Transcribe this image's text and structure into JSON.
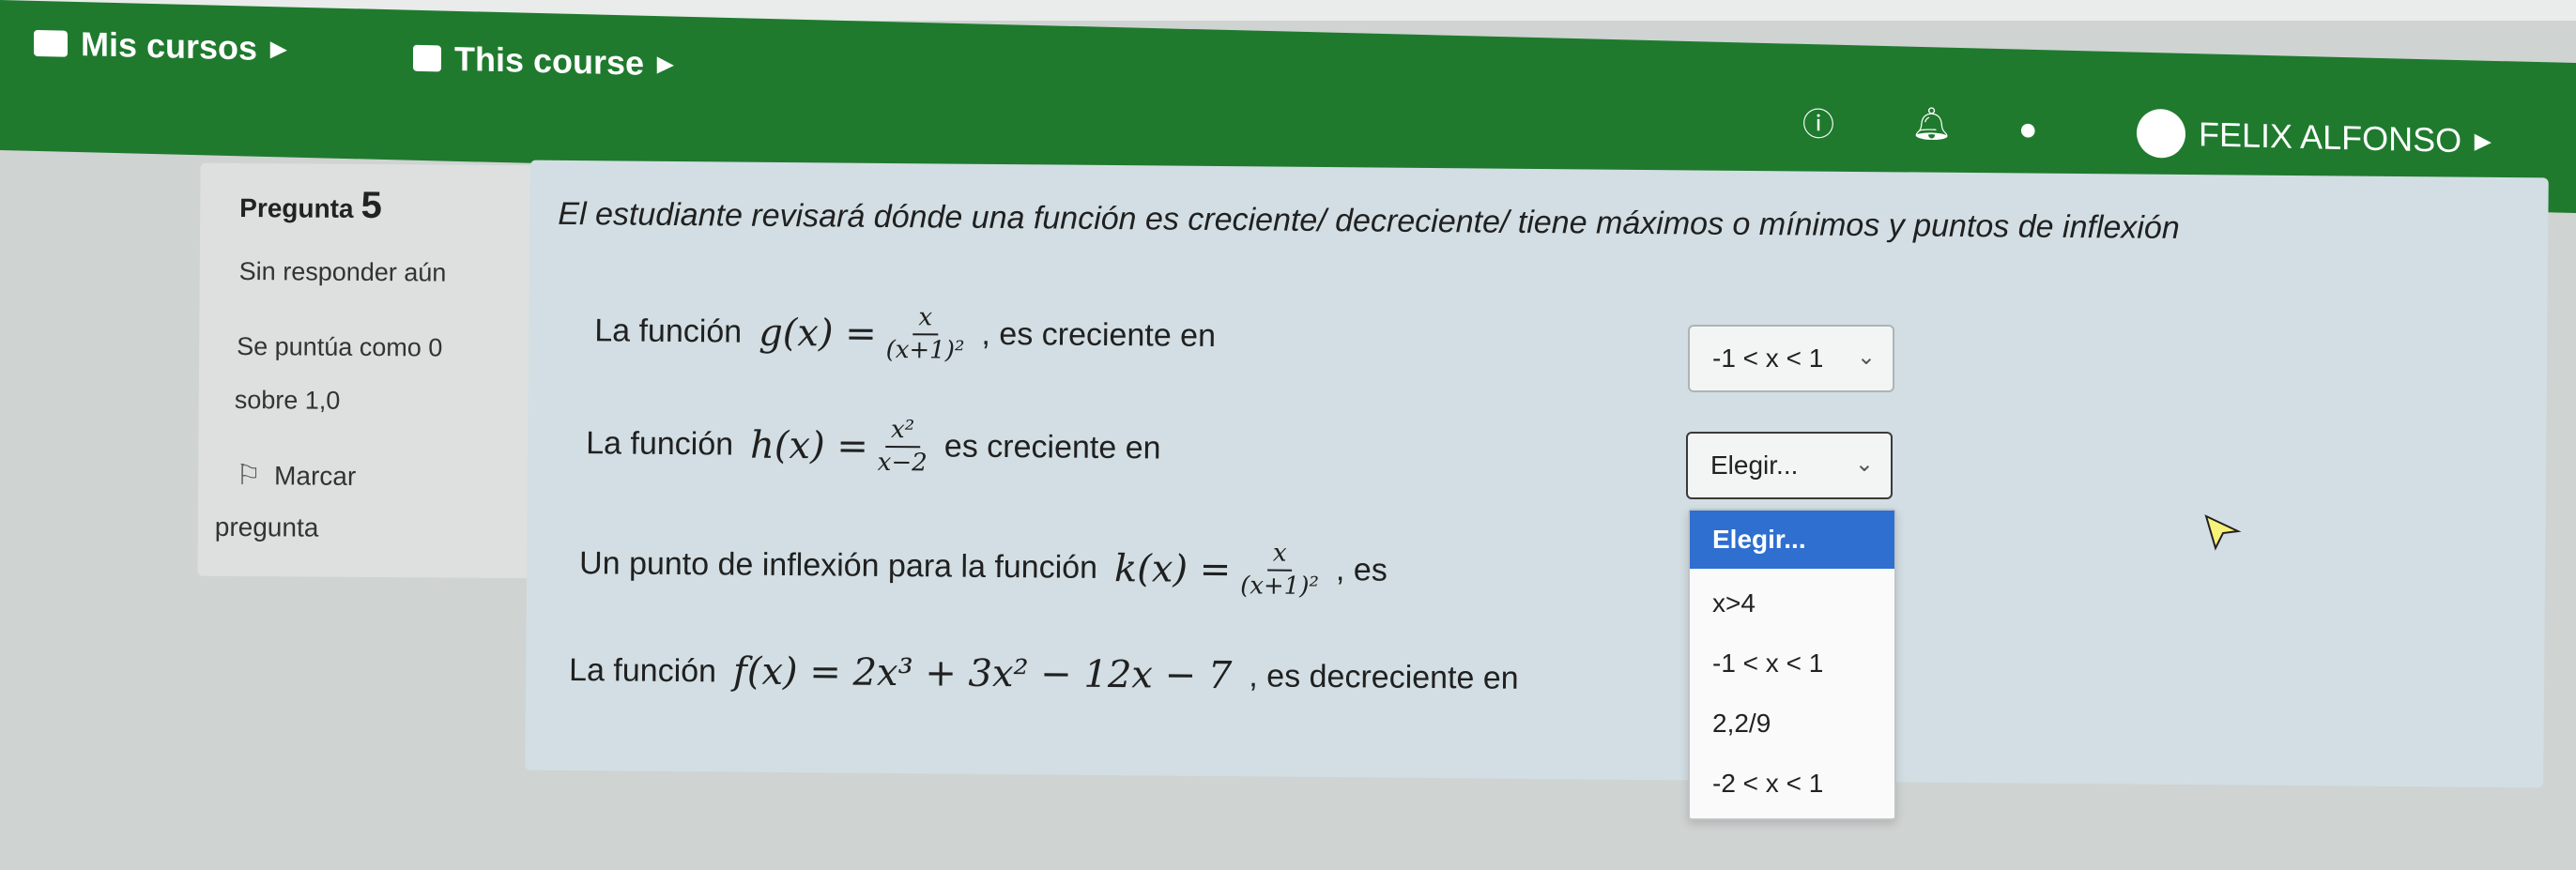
{
  "header": {
    "nav": [
      {
        "label": "Mis cursos"
      },
      {
        "label": "This course"
      }
    ],
    "user_name": "FELIX ALFONSO"
  },
  "question": {
    "label": "Pregunta",
    "number": "5",
    "status": "Sin responder aún",
    "grade_line1": "Se puntúa como 0",
    "grade_line2": "sobre 1,0",
    "flag_line1": "Marcar",
    "flag_line2": "pregunta"
  },
  "content": {
    "intro": "El estudiante revisará dónde una función es creciente/ decreciente/ tiene máximos o mínimos y puntos de inflexión",
    "items": [
      {
        "prefix": "La función",
        "func": "g(x) =",
        "num": "x",
        "den": "(x+1)²",
        "suffix": ", es creciente en",
        "selected": "-1 < x < 1"
      },
      {
        "prefix": "La función",
        "func": "h(x) =",
        "num": "x²",
        "den": "x−2",
        "suffix": "es creciente en",
        "selected": "Elegir..."
      },
      {
        "prefix": "Un punto de inflexión para la función",
        "func": "k(x) =",
        "num": "x",
        "den": "(x+1)²",
        "suffix": ", es",
        "selected": "Elegir..."
      },
      {
        "prefix": "La función",
        "func": "f(x) = 2x³ + 3x² − 12x − 7",
        "suffix": ", es decreciente en"
      }
    ]
  },
  "dropdown": {
    "options": [
      "Elegir...",
      "x>4",
      "-1 < x < 1",
      "2,2/9",
      "-2 < x < 1"
    ]
  }
}
